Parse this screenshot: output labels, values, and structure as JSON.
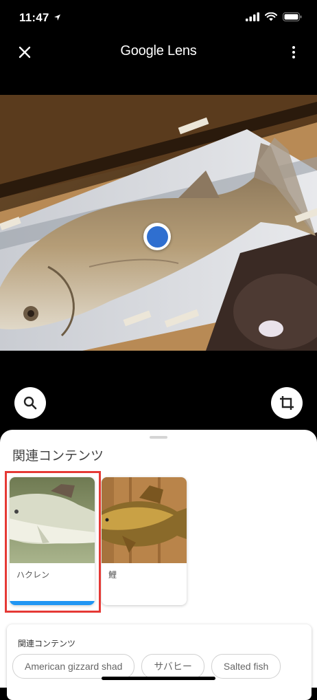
{
  "status_bar": {
    "time": "11:47"
  },
  "app_bar": {
    "title": "Google Lens"
  },
  "sheet": {
    "title": "関連コンテンツ",
    "cards": [
      {
        "label": "ハクレン",
        "selected": true
      },
      {
        "label": "鯉",
        "selected": false
      }
    ]
  },
  "related": {
    "title": "関連コンテンツ",
    "chips": [
      "American gizzard shad",
      "サバヒー",
      "Salted fish"
    ]
  },
  "colors": {
    "accent": "#2f6fd0",
    "selection_bar": "#2196f3",
    "highlight": "#e53935"
  },
  "icons": {
    "close": "close-icon",
    "more": "more-vert-icon",
    "search": "search-icon",
    "crop": "crop-icon",
    "signal": "signal-icon",
    "wifi": "wifi-icon",
    "battery": "battery-icon",
    "location": "location-arrow-icon"
  }
}
